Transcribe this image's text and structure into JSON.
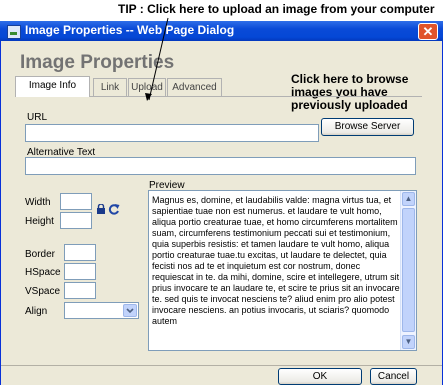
{
  "annotation": {
    "tip": "TIP : Click here to upload an image from your computer",
    "callout_lines": [
      "Click here to browse",
      "images you have",
      "previously uploaded"
    ]
  },
  "window": {
    "title": "Image Properties -- Web Page Dialog",
    "close_glyph": "✕",
    "heading": "Image Properties"
  },
  "tabs": [
    {
      "label": "Image Info",
      "active": true
    },
    {
      "label": "Link",
      "active": false
    },
    {
      "label": "Upload",
      "active": false
    },
    {
      "label": "Advanced",
      "active": false
    }
  ],
  "form": {
    "url_label": "URL",
    "url_value": "",
    "browse_button": "Browse Server",
    "alt_label": "Alternative Text",
    "alt_value": "",
    "width_label": "Width",
    "height_label": "Height",
    "width_value": "",
    "height_value": "",
    "lock_icon": "lock-icon",
    "reset_icon": "reset-size-icon",
    "border_label": "Border",
    "hspace_label": "HSpace",
    "vspace_label": "VSpace",
    "align_label": "Align",
    "border_value": "",
    "hspace_value": "",
    "vspace_value": "",
    "align_value": ""
  },
  "preview": {
    "label": "Preview",
    "text": "Magnus es, domine, et laudabilis valde: magna virtus tua, et sapientiae tuae non est numerus. et laudare te vult homo, aliqua portio creaturae tuae, et homo circumferens mortalitem suam, circumferens testimonium peccati sui et testimonium, quia superbis resistis: et tamen laudare te vult homo, aliqua portio creaturae tuae.tu excitas, ut laudare te delectet, quia fecisti nos ad te et inquietum est cor nostrum, donec requiescat in te. da mihi, domine, scire et intellegere, utrum sit prius invocare te an laudare te, et scire te prius sit an invocare te. sed quis te invocat nesciens te? aliud enim pro alio potest invocare nesciens. an potius invocaris, ut sciaris? quomodo autem"
  },
  "footer": {
    "ok": "OK",
    "cancel": "Cancel"
  },
  "colors": {
    "titlebar": "#0548d6",
    "dialog_bg": "#ece9d8",
    "heading": "#737373"
  }
}
